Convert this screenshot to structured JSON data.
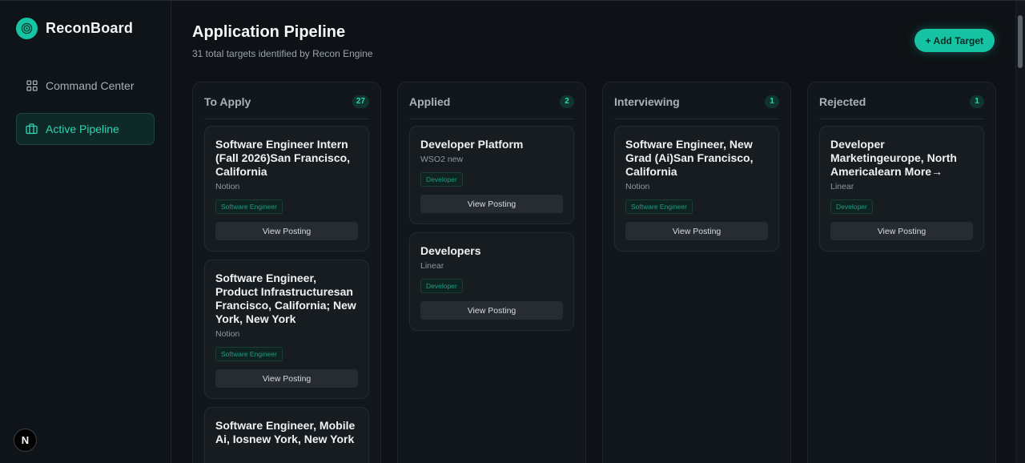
{
  "brand": {
    "name": "ReconBoard"
  },
  "sidebar": {
    "items": [
      {
        "label": "Command Center",
        "icon": "grid-icon",
        "active": false
      },
      {
        "label": "Active Pipeline",
        "icon": "briefcase-icon",
        "active": true
      }
    ],
    "footer_badge": "N"
  },
  "header": {
    "title": "Application Pipeline",
    "subtitle": "31 total targets identified by Recon Engine",
    "add_label": "+ Add Target"
  },
  "columns": [
    {
      "title": "To Apply",
      "count": "27",
      "cards": [
        {
          "title": "Software Engineer Intern (Fall 2026)San Francisco, California",
          "company": "Notion",
          "tag": "Software Engineer",
          "button": "View Posting"
        },
        {
          "title": "Software Engineer, Product Infrastructuresan Francisco, California; New York, New York",
          "company": "Notion",
          "tag": "Software Engineer",
          "button": "View Posting"
        },
        {
          "title": "Software Engineer, Mobile Ai, Iosnew York, New York",
          "company": "",
          "tag": "",
          "button": ""
        }
      ]
    },
    {
      "title": "Applied",
      "count": "2",
      "cards": [
        {
          "title": "Developer Platform",
          "company": "WSO2 new",
          "tag": "Developer",
          "button": "View Posting"
        },
        {
          "title": "Developers",
          "company": "Linear",
          "tag": "Developer",
          "button": "View Posting"
        }
      ]
    },
    {
      "title": "Interviewing",
      "count": "1",
      "cards": [
        {
          "title": "Software Engineer, New Grad (Ai)San Francisco, California",
          "company": "Notion",
          "tag": "Software Engineer",
          "button": "View Posting"
        }
      ]
    },
    {
      "title": "Rejected",
      "count": "1",
      "cards": [
        {
          "title": "Developer Marketingeurope, North Americalearn More→",
          "company": "Linear",
          "tag": "Developer",
          "button": "View Posting"
        }
      ]
    }
  ],
  "colors": {
    "accent": "#16c4a4",
    "background": "#0e1216",
    "panel": "#12171c"
  }
}
